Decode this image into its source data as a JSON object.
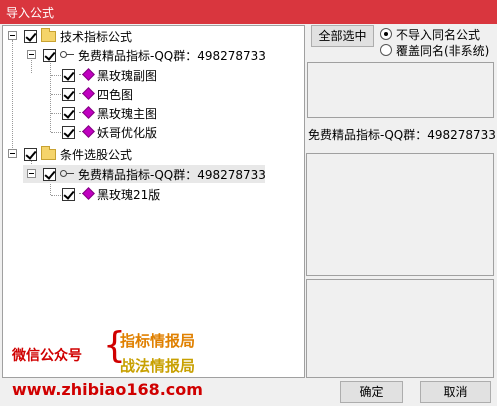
{
  "window": {
    "title": "导入公式"
  },
  "tree": {
    "group1": {
      "label": "技术指标公式"
    },
    "group1_sub": {
      "label": "免费精品指标-QQ群：498278733"
    },
    "group1_items": [
      "黑玫瑰副图",
      "四色图",
      "黑玫瑰主图",
      "妖哥优化版"
    ],
    "group2": {
      "label": "条件选股公式"
    },
    "group2_sub": {
      "label": "免费精品指标-QQ群：498278733"
    },
    "group2_items": [
      "黑玫瑰21版"
    ]
  },
  "actions": {
    "select_all": "全部选中",
    "no_import_same": "不导入同名公式",
    "overwrite_same": "覆盖同名(非系统)"
  },
  "info": {
    "text": "免费精品指标-QQ群：498278733"
  },
  "watermark": {
    "wechat": "微信公众号",
    "brace": "{",
    "line1": "指标情报局",
    "line2": "战法情报局",
    "url": "www.zhibiao168.com"
  },
  "footer": {
    "ok": "确定",
    "cancel": "取消"
  }
}
